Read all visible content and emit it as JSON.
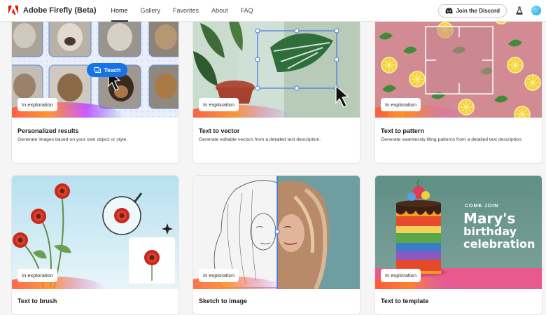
{
  "app": {
    "brand": "Adobe Firefly (Beta)",
    "nav": [
      "Home",
      "Gallery",
      "Favorites",
      "About",
      "FAQ"
    ],
    "active_nav": "Home",
    "discord_label": "Join the Discord",
    "icons": {
      "logo": "adobe-logo-icon",
      "discord": "discord-icon",
      "labs": "flask-icon",
      "avatar": "user-avatar"
    },
    "colors": {
      "accent": "#1473e6",
      "brand_red": "#eb1000"
    }
  },
  "cards": [
    {
      "id": "personalized",
      "title": "Personalized results",
      "description": "Generate images based on your own object or style.",
      "badge": "In exploration",
      "action": "Teach"
    },
    {
      "id": "vector",
      "title": "Text to vector",
      "description": "Generate editable vectors from a detailed text description.",
      "badge": "In exploration"
    },
    {
      "id": "pattern",
      "title": "Text to pattern",
      "description": "Generate seamlessly tiling patterns from a detailed text description.",
      "badge": "In exploration"
    },
    {
      "id": "brush",
      "title": "Text to brush",
      "description": "",
      "badge": "In exploration"
    },
    {
      "id": "sketch",
      "title": "Sketch to image",
      "description": "",
      "badge": "In exploration"
    },
    {
      "id": "template",
      "title": "Text to template",
      "description": "",
      "badge": "In exploration",
      "image_text": {
        "line1": "Come join",
        "line2": "Mary's",
        "line3": "birthday",
        "line4": "celebration"
      }
    }
  ]
}
